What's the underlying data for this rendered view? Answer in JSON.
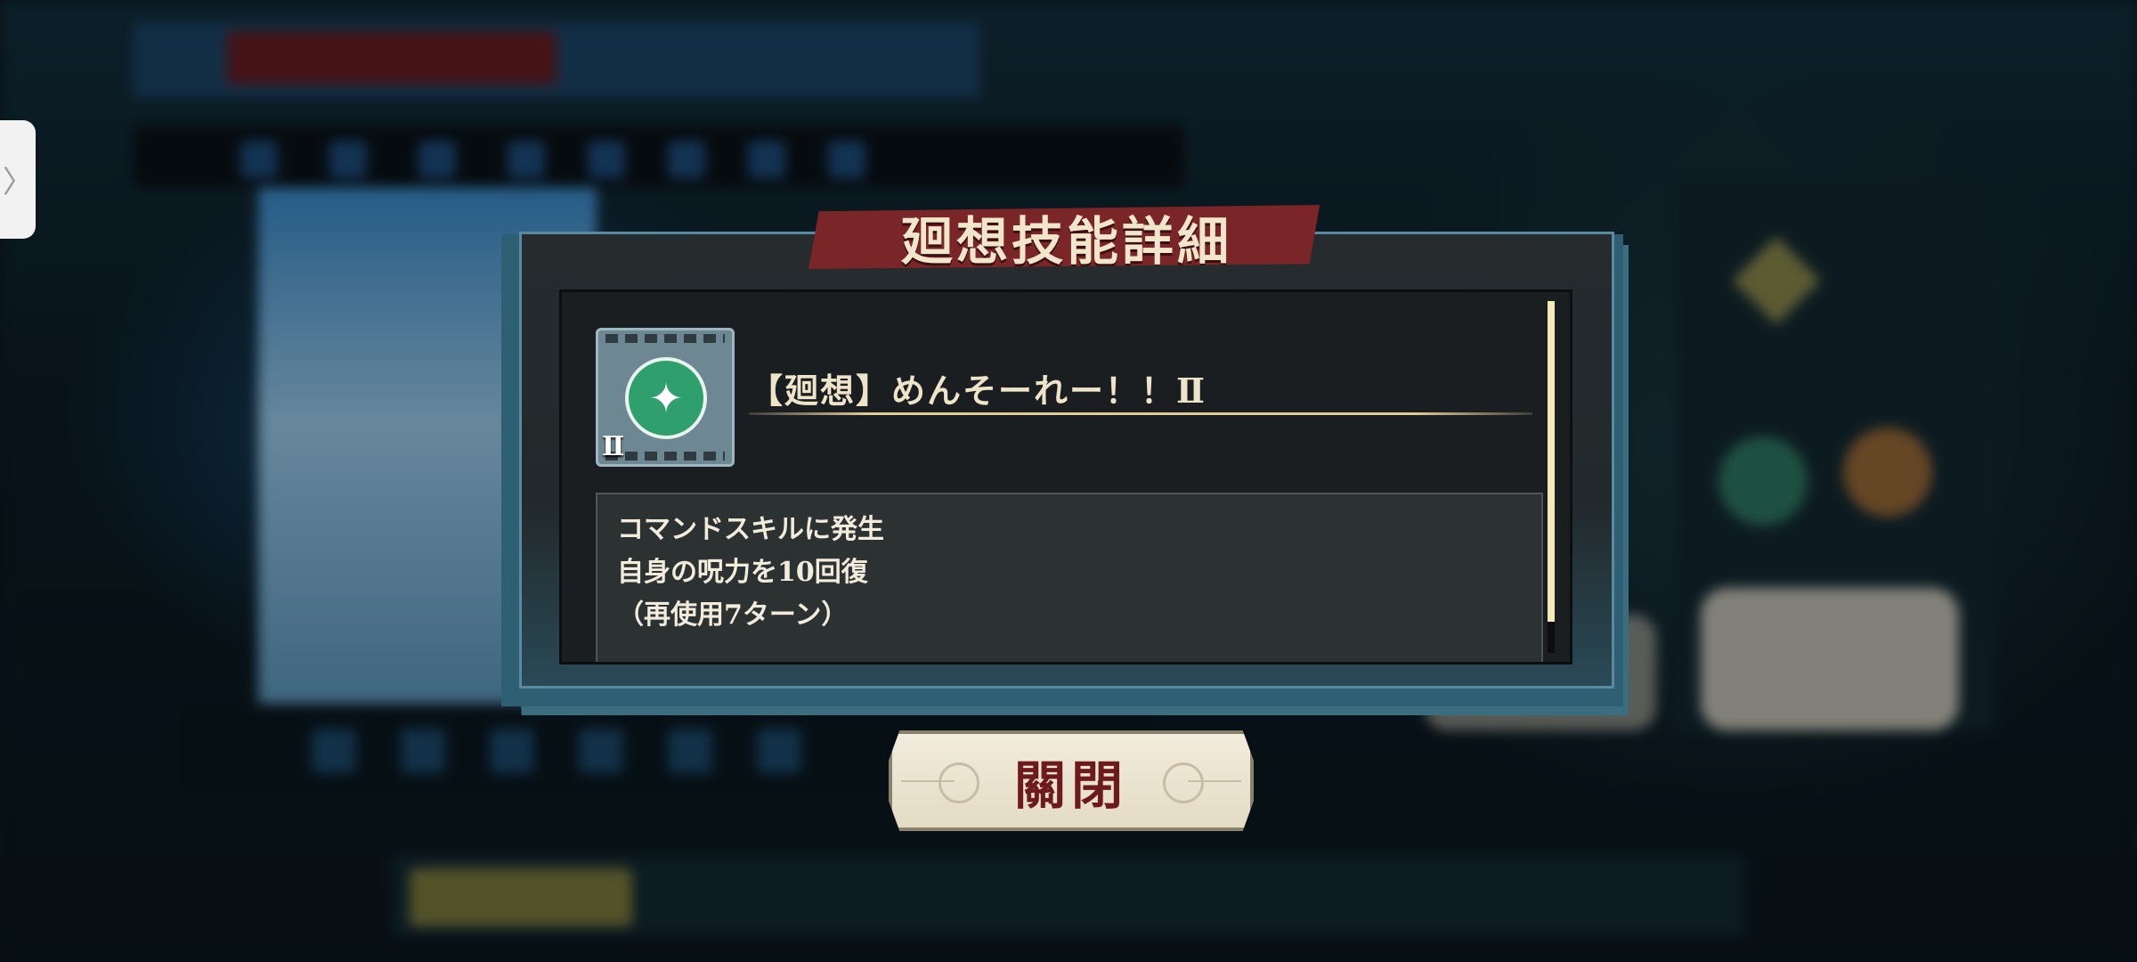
{
  "dialog": {
    "title": "廻想技能詳細",
    "skill": {
      "name": "【廻想】めんそーれー！！Ⅱ",
      "rank": "Ⅱ",
      "icon": "skill-icon"
    },
    "description": [
      "コマンドスキルに発生",
      "自身の呪力を10回復",
      "（再使用7ターン）"
    ]
  },
  "close_button": {
    "label": "關閉"
  },
  "side_handle": {
    "glyph": "〉"
  },
  "colors": {
    "title_banner": "#7a2628",
    "close_label": "#6d1a1c",
    "scroll_thumb": "#f3e9b9",
    "skill_disc": "#2f9f6e"
  }
}
